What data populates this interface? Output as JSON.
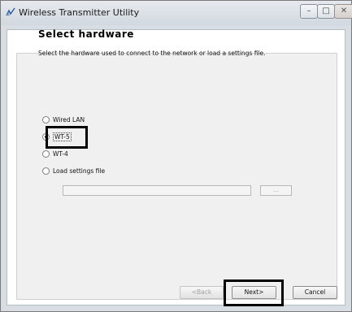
{
  "window": {
    "title": "Wireless Transmitter Utility",
    "controls": {
      "minimize": "–",
      "maximize": "□",
      "close": "✕"
    }
  },
  "page": {
    "heading": "Select hardware",
    "description": "Select the hardware used to connect to the network or load a settings file."
  },
  "options": [
    {
      "label": "Wired LAN",
      "selected": false
    },
    {
      "label": "WT-5",
      "selected": true
    },
    {
      "label": "WT-4",
      "selected": false
    },
    {
      "label": "Load settings file",
      "selected": false
    }
  ],
  "settings_file": {
    "path_value": "",
    "browse_label": "..."
  },
  "buttons": {
    "back": "<Back",
    "next": "Next>",
    "cancel": "Cancel"
  },
  "highlight_color": "#000000"
}
